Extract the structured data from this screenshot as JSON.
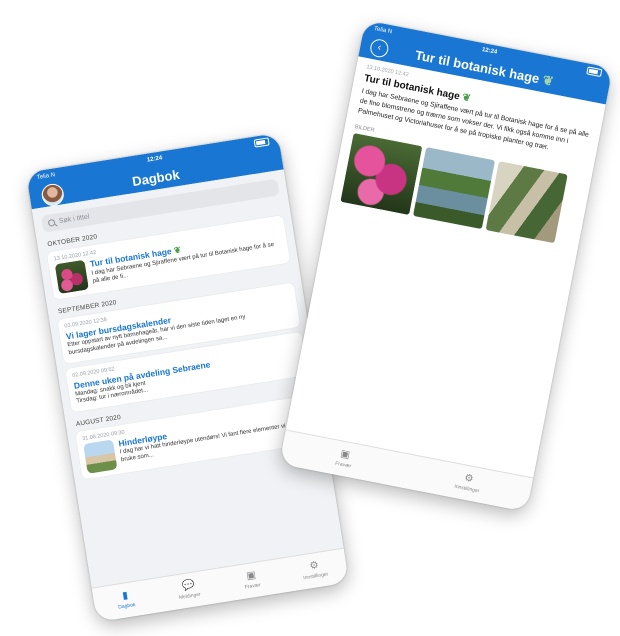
{
  "left_screen": {
    "status": {
      "carrier": "Telia N",
      "time": "12:24"
    },
    "header": {
      "title": "Dagbok"
    },
    "search": {
      "placeholder": "Søk i tittel"
    },
    "sections": [
      {
        "label": "OKTOBER 2020",
        "entries": [
          {
            "date": "13.10.2020 12:42",
            "title": "Tur til botanisk hage",
            "excerpt": "I dag har Sebraene og Sjiraffene vært på tur til Botanisk hage for å se på alle de fi..."
          }
        ]
      },
      {
        "label": "SEPTEMBER 2020",
        "entries": [
          {
            "date": "03.09.2020 12:38",
            "title": "Vi lager bursdagskalender",
            "excerpt": "Etter oppstart av nytt barnehageår, har vi den siste tiden laget en ny bursdagskalender på avdelingen sa..."
          },
          {
            "date": "02.09.2020 09:52",
            "title": "Denne uken på avdeling Sebraene",
            "excerpt": "Mandag: snakk og bli kjent\nTirsdag: tur i nærområdet..."
          }
        ]
      },
      {
        "label": "AUGUST 2020",
        "entries": [
          {
            "date": "31.08.2020 09:30",
            "title": "Hinderløype",
            "excerpt": "I dag har vi hatt hinderløype utendørs! Vi fant flere elementer vi kunne bruke som..."
          }
        ]
      }
    ],
    "tabs": [
      {
        "label": "Dagbok",
        "icon": "book-icon"
      },
      {
        "label": "Meldinger",
        "icon": "chat-icon"
      },
      {
        "label": "Fravær",
        "icon": "calendar-icon"
      },
      {
        "label": "Innstillinger",
        "icon": "gear-icon"
      }
    ]
  },
  "right_screen": {
    "status": {
      "carrier": "Telia N",
      "time": "12:24"
    },
    "header": {
      "title": "Tur til botanisk hage"
    },
    "post": {
      "date": "13.10.2020 12:42",
      "title": "Tur til botanisk hage",
      "body": "I dag har Sebraene og Sjiraffene vært på tur til Botanisk hage for å se på alle de fine blomstrene og trærne som vokser der. Vi fikk også komme inn i Palmehuset og Victoriahuset for å se på tropiske planter og trær.",
      "images_label": "BILDER"
    },
    "tabs": [
      {
        "label": "Fravær",
        "icon": "calendar-icon"
      },
      {
        "label": "Innstillinger",
        "icon": "gear-icon"
      }
    ]
  }
}
